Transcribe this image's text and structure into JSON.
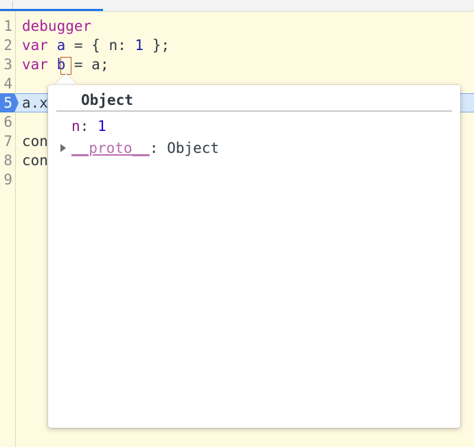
{
  "editor": {
    "lines": [
      {
        "num": "1",
        "tokens": [
          {
            "t": "debugger",
            "c": "kw"
          }
        ]
      },
      {
        "num": "2",
        "tokens": [
          {
            "t": "var",
            "c": "kw"
          },
          {
            "t": " ",
            "c": "plain"
          },
          {
            "t": "a",
            "c": "var"
          },
          {
            "t": " = { n: ",
            "c": "plain"
          },
          {
            "t": "1",
            "c": "num"
          },
          {
            "t": " };",
            "c": "plain"
          }
        ]
      },
      {
        "num": "3",
        "tokens": [
          {
            "t": "var",
            "c": "kw"
          },
          {
            "t": " ",
            "c": "plain"
          },
          {
            "t": "b",
            "c": "var"
          },
          {
            "t": " = a;",
            "c": "plain"
          }
        ]
      },
      {
        "num": "4",
        "tokens": []
      },
      {
        "num": "5",
        "tokens": [
          {
            "t": "a.x",
            "c": "plain"
          }
        ]
      },
      {
        "num": "6",
        "tokens": []
      },
      {
        "num": "7",
        "tokens": [
          {
            "t": "con",
            "c": "plain"
          }
        ]
      },
      {
        "num": "8",
        "tokens": [
          {
            "t": "con",
            "c": "plain"
          }
        ]
      },
      {
        "num": "9",
        "tokens": []
      }
    ],
    "execution_line": "5"
  },
  "popover": {
    "title": "Object",
    "properties": [
      {
        "name": "n",
        "separator": ": ",
        "value": "1",
        "expandable": false
      },
      {
        "name": "__proto__",
        "separator": ": ",
        "value": "Object",
        "expandable": true
      }
    ]
  },
  "colors": {
    "editor_background": "#fffbe1",
    "keyword": "#a3209b",
    "variable": "#2320a8",
    "execution_line": "#d7e8fb",
    "breakpoint_marker": "#4c86e8"
  }
}
